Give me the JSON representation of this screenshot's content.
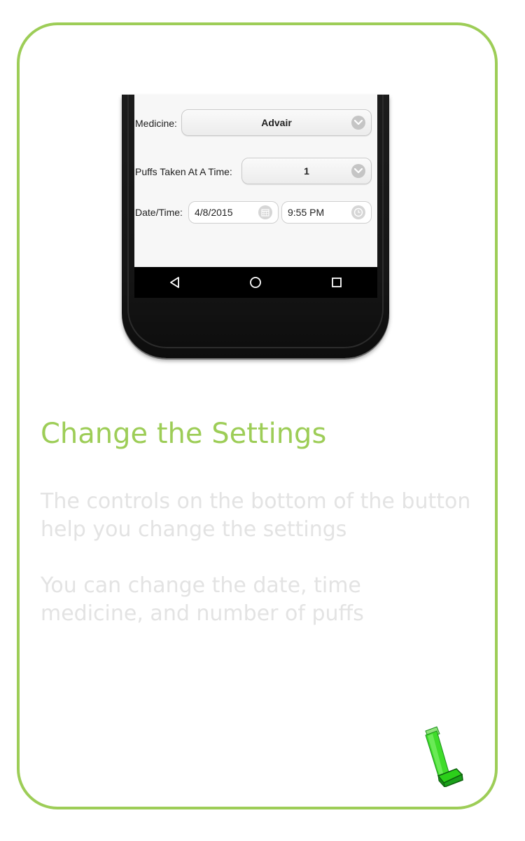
{
  "colors": {
    "accent": "#9dcd57",
    "body_text": "#e3e3e3",
    "phone_body": "#151515"
  },
  "form": {
    "medicine": {
      "label": "Medicine:",
      "value": "Advair"
    },
    "puffs": {
      "label": "Puffs Taken At A Time:",
      "value": "1"
    },
    "datetime": {
      "label": "Date/Time:",
      "date": "4/8/2015",
      "time": "9:55 PM"
    }
  },
  "nav": {
    "back_icon": "back-triangle-icon",
    "home_icon": "home-circle-icon",
    "recents_icon": "recents-square-icon"
  },
  "title": "Change the Settings",
  "paragraphs": [
    {
      "line1": "The controls on the bottom of the button",
      "line2": "help you change the settings"
    },
    {
      "line1": "You can change the date, time",
      "line2": "medicine, and number of puffs"
    }
  ],
  "logo_icon": "inhaler-icon"
}
